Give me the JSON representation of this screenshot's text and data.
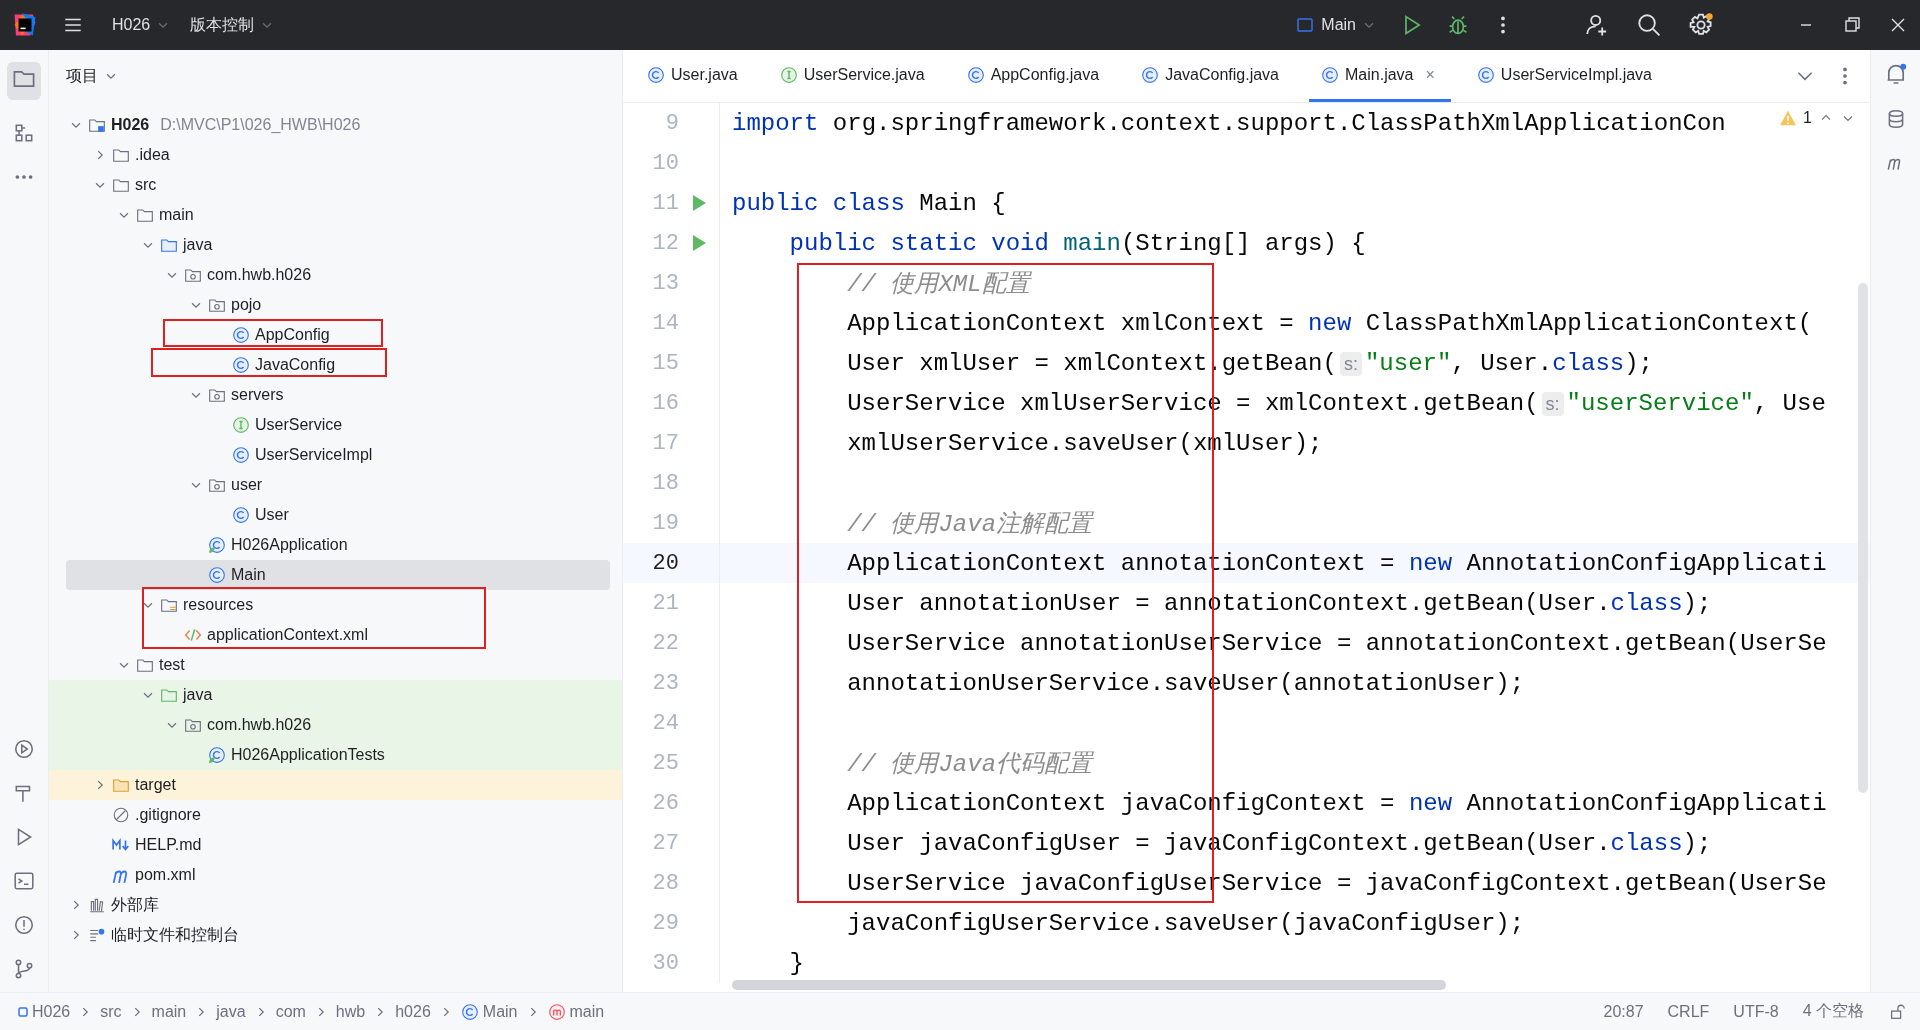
{
  "title_bar": {
    "project": "H026",
    "vcs": "版本控制",
    "run_config": "Main"
  },
  "project_panel": {
    "title": "项目",
    "tree": [
      {
        "label": "H026",
        "path": "D:\\MVC\\P1\\026_HWB\\H026",
        "kind": "module",
        "expanded": true,
        "selected": false,
        "children": [
          {
            "label": ".idea",
            "kind": "folder",
            "expanded": false,
            "selected": false
          },
          {
            "label": "src",
            "kind": "folder",
            "expanded": true,
            "selected": false,
            "children": [
              {
                "label": "main",
                "kind": "folder",
                "expanded": true,
                "selected": false,
                "children": [
                  {
                    "label": "java",
                    "kind": "source",
                    "expanded": true,
                    "selected": false,
                    "children": [
                      {
                        "label": "com.hwb.h026",
                        "kind": "package",
                        "expanded": true,
                        "selected": false,
                        "children": [
                          {
                            "label": "pojo",
                            "kind": "package",
                            "expanded": true,
                            "selected": false,
                            "children": [
                              {
                                "label": "AppConfig",
                                "kind": "class",
                                "selected": false
                              },
                              {
                                "label": "JavaConfig",
                                "kind": "class",
                                "selected": false
                              }
                            ]
                          },
                          {
                            "label": "servers",
                            "kind": "package",
                            "expanded": true,
                            "selected": false,
                            "children": [
                              {
                                "label": "UserService",
                                "kind": "interface",
                                "selected": false
                              },
                              {
                                "label": "UserServiceImpl",
                                "kind": "class",
                                "selected": false
                              }
                            ]
                          },
                          {
                            "label": "user",
                            "kind": "package",
                            "expanded": true,
                            "selected": false,
                            "children": [
                              {
                                "label": "User",
                                "kind": "class",
                                "selected": false
                              }
                            ]
                          },
                          {
                            "label": "H026Application",
                            "kind": "spring",
                            "selected": false
                          },
                          {
                            "label": "Main",
                            "kind": "class",
                            "selected": true
                          }
                        ]
                      }
                    ]
                  },
                  {
                    "label": "resources",
                    "kind": "resources",
                    "expanded": true,
                    "selected": false,
                    "children": [
                      {
                        "label": "applicationContext.xml",
                        "kind": "xml",
                        "selected": false
                      }
                    ]
                  }
                ]
              },
              {
                "label": "test",
                "kind": "folder",
                "expanded": true,
                "selected": false,
                "children": [
                  {
                    "label": "java",
                    "kind": "testsource",
                    "expanded": true,
                    "selected": false,
                    "test": true,
                    "children": [
                      {
                        "label": "com.hwb.h026",
                        "kind": "package",
                        "expanded": true,
                        "selected": false,
                        "test": true,
                        "children": [
                          {
                            "label": "H026ApplicationTests",
                            "kind": "spring",
                            "selected": false,
                            "test": true
                          }
                        ]
                      }
                    ]
                  }
                ]
              }
            ]
          },
          {
            "label": "target",
            "kind": "excluded",
            "expanded": false,
            "selected": false,
            "excluded": true
          },
          {
            "label": ".gitignore",
            "kind": "ignore",
            "selected": false
          },
          {
            "label": "HELP.md",
            "kind": "markdown",
            "selected": false
          },
          {
            "label": "pom.xml",
            "kind": "maven",
            "selected": false
          }
        ]
      },
      {
        "label": "外部库",
        "kind": "library",
        "expanded": false,
        "selected": false
      },
      {
        "label": "临时文件和控制台",
        "kind": "scratch",
        "expanded": false,
        "selected": false
      }
    ]
  },
  "tabs": [
    {
      "label": "User.java",
      "kind": "class",
      "selected": false
    },
    {
      "label": "UserService.java",
      "kind": "interface",
      "selected": false
    },
    {
      "label": "AppConfig.java",
      "kind": "class",
      "selected": false
    },
    {
      "label": "JavaConfig.java",
      "kind": "class",
      "selected": false
    },
    {
      "label": "Main.java",
      "kind": "class",
      "selected": true,
      "close": "×"
    },
    {
      "label": "UserServiceImpl.java",
      "kind": "class",
      "selected": false
    }
  ],
  "editor": {
    "warnings": "1",
    "lines": [
      {
        "number": "9",
        "run": false,
        "current": false,
        "segments": [
          {
            "kind": "keyword",
            "text": "import"
          },
          {
            "kind": "plain",
            "text": " org.springframework.context.support.ClassPathXmlApplicationCon"
          }
        ]
      },
      {
        "number": "10",
        "run": false,
        "current": false
      },
      {
        "number": "11",
        "run": true,
        "current": false,
        "segments": [
          {
            "kind": "keyword",
            "text": "public class"
          },
          {
            "kind": "plain",
            "text": " Main {"
          }
        ]
      },
      {
        "number": "12",
        "run": true,
        "current": false,
        "segments": [
          {
            "kind": "keyword",
            "text": "    public static void"
          },
          {
            "kind": "method",
            "text": " main"
          },
          {
            "kind": "plain",
            "text": "(String[] args) {"
          }
        ]
      },
      {
        "number": "13",
        "run": false,
        "current": false,
        "segments": [
          {
            "kind": "comment",
            "text": "        // 使用XML配置"
          }
        ]
      },
      {
        "number": "14",
        "run": false,
        "current": false,
        "segments": [
          {
            "kind": "plain",
            "text": "        ApplicationContext xmlContext = "
          },
          {
            "kind": "keyword",
            "text": "new"
          },
          {
            "kind": "plain",
            "text": " ClassPathXmlApplicationContext("
          }
        ]
      },
      {
        "number": "15",
        "run": false,
        "current": false,
        "segments": [
          {
            "kind": "plain",
            "text": "        User xmlUser = xmlContext.getBean("
          },
          {
            "kind": "hint",
            "text": "s:"
          },
          {
            "kind": "string",
            "text": "\"user\""
          },
          {
            "kind": "plain",
            "text": ", User."
          },
          {
            "kind": "keyword",
            "text": "class"
          },
          {
            "kind": "plain",
            "text": ");"
          }
        ]
      },
      {
        "number": "16",
        "run": false,
        "current": false,
        "segments": [
          {
            "kind": "plain",
            "text": "        UserService xmlUserService = xmlContext.getBean("
          },
          {
            "kind": "hint",
            "text": "s:"
          },
          {
            "kind": "string",
            "text": "\"userService\""
          },
          {
            "kind": "plain",
            "text": ", Use"
          }
        ]
      },
      {
        "number": "17",
        "run": false,
        "current": false,
        "segments": [
          {
            "kind": "plain",
            "text": "        xmlUserService.saveUser(xmlUser);"
          }
        ]
      },
      {
        "number": "18",
        "run": false,
        "current": false
      },
      {
        "number": "19",
        "run": false,
        "current": false,
        "segments": [
          {
            "kind": "comment",
            "text": "        // 使用Java注解配置"
          }
        ]
      },
      {
        "number": "20",
        "run": false,
        "current": true,
        "segments": [
          {
            "kind": "plain",
            "text": "        ApplicationContext annotationContext = "
          },
          {
            "kind": "keyword",
            "text": "new"
          },
          {
            "kind": "plain",
            "text": " AnnotationConfigApplicati"
          }
        ]
      },
      {
        "number": "21",
        "run": false,
        "current": false,
        "segments": [
          {
            "kind": "plain",
            "text": "        User annotationUser = annotationContext.getBean(User."
          },
          {
            "kind": "keyword",
            "text": "class"
          },
          {
            "kind": "plain",
            "text": ");"
          }
        ]
      },
      {
        "number": "22",
        "run": false,
        "current": false,
        "segments": [
          {
            "kind": "plain",
            "text": "        UserService annotationUserService = annotationContext.getBean(UserSe"
          }
        ]
      },
      {
        "number": "23",
        "run": false,
        "current": false,
        "segments": [
          {
            "kind": "plain",
            "text": "        annotationUserService.saveUser(annotationUser);"
          }
        ]
      },
      {
        "number": "24",
        "run": false,
        "current": false
      },
      {
        "number": "25",
        "run": false,
        "current": false,
        "segments": [
          {
            "kind": "comment",
            "text": "        // 使用Java代码配置"
          }
        ]
      },
      {
        "number": "26",
        "run": false,
        "current": false,
        "segments": [
          {
            "kind": "plain",
            "text": "        ApplicationContext javaConfigContext = "
          },
          {
            "kind": "keyword",
            "text": "new"
          },
          {
            "kind": "plain",
            "text": " AnnotationConfigApplicati"
          }
        ]
      },
      {
        "number": "27",
        "run": false,
        "current": false,
        "segments": [
          {
            "kind": "plain",
            "text": "        User javaConfigUser = javaConfigContext.getBean(User."
          },
          {
            "kind": "keyword",
            "text": "class"
          },
          {
            "kind": "plain",
            "text": ");"
          }
        ]
      },
      {
        "number": "28",
        "run": false,
        "current": false,
        "segments": [
          {
            "kind": "plain",
            "text": "        UserService javaConfigUserService = javaConfigContext.getBean(UserSe"
          }
        ]
      },
      {
        "number": "29",
        "run": false,
        "current": false,
        "segments": [
          {
            "kind": "plain",
            "text": "        javaConfigUserService.saveUser(javaConfigUser);"
          }
        ]
      },
      {
        "number": "30",
        "run": false,
        "current": false,
        "segments": [
          {
            "kind": "plain",
            "text": "    }"
          }
        ]
      }
    ]
  },
  "breadcrumbs": [
    {
      "label": "H026",
      "kind": "module"
    },
    {
      "label": "src"
    },
    {
      "label": "main"
    },
    {
      "label": "java"
    },
    {
      "label": "com"
    },
    {
      "label": "hwb"
    },
    {
      "label": "h026"
    },
    {
      "label": "Main",
      "kind": "class"
    },
    {
      "label": "main",
      "kind": "method"
    }
  ],
  "status": [
    "20:87",
    "CRLF",
    "UTF-8",
    "4 个空格"
  ]
}
